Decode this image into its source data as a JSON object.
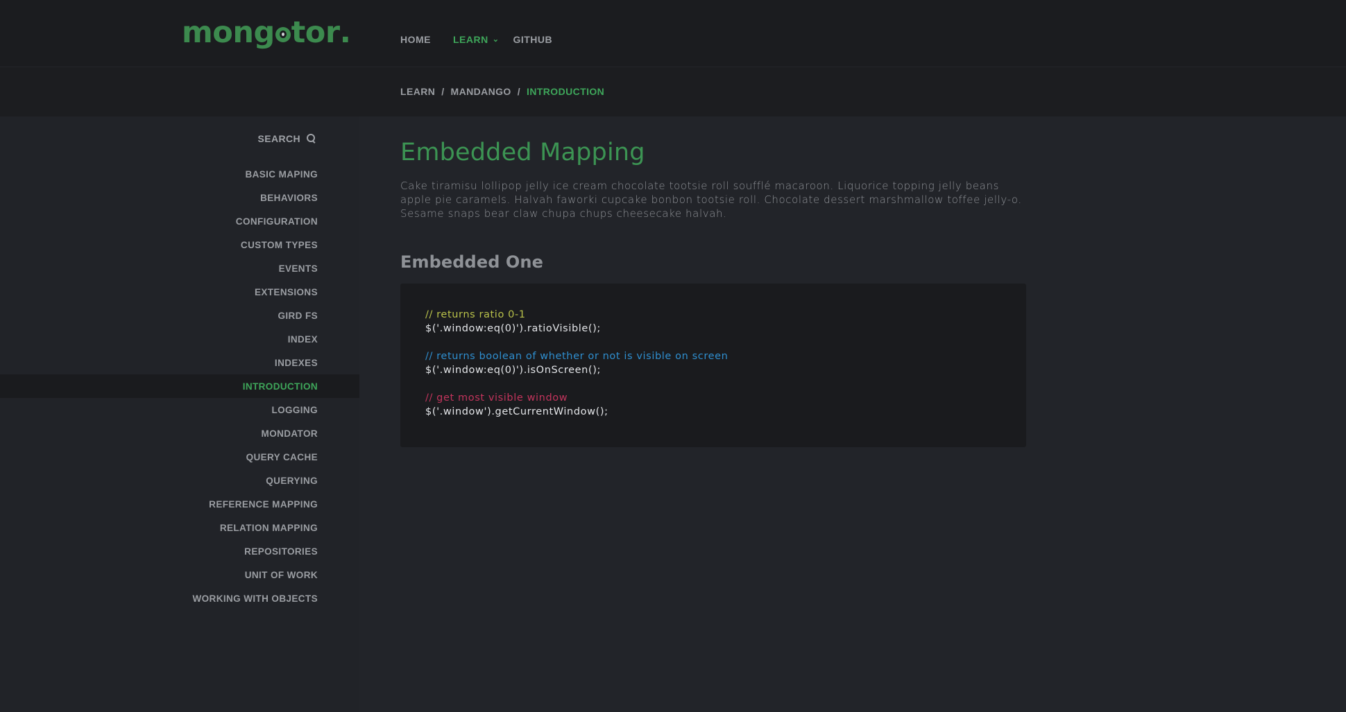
{
  "brand": {
    "logo_prefix": "mong",
    "logo_suffix": "tor",
    "logo_dot": ".",
    "accent": "#3ea65a"
  },
  "nav": {
    "items": [
      {
        "label": "HOME"
      },
      {
        "label": "LEARN",
        "active": true,
        "has_dropdown": true
      },
      {
        "label": "GITHUB"
      }
    ]
  },
  "breadcrumb": {
    "items": [
      "LEARN",
      "MANDANGO",
      "INTRODUCTION"
    ],
    "separator": "/"
  },
  "sidebar": {
    "search_label": "SEARCH",
    "items": [
      {
        "label": "BASIC MAPING"
      },
      {
        "label": "BEHAVIORS"
      },
      {
        "label": "CONFIGURATION"
      },
      {
        "label": "CUSTOM TYPES"
      },
      {
        "label": "EVENTS"
      },
      {
        "label": "EXTENSIONS"
      },
      {
        "label": "GIRD FS"
      },
      {
        "label": "INDEX"
      },
      {
        "label": "INDEXES"
      },
      {
        "label": "INTRODUCTION",
        "active": true
      },
      {
        "label": "LOGGING"
      },
      {
        "label": "MONDATOR"
      },
      {
        "label": "QUERY CACHE"
      },
      {
        "label": "QUERYING"
      },
      {
        "label": "REFERENCE MAPPING"
      },
      {
        "label": "RELATION MAPPING"
      },
      {
        "label": "REPOSITORIES"
      },
      {
        "label": "UNIT OF WORK"
      },
      {
        "label": "WORKING WITH OBJECTS"
      }
    ]
  },
  "main": {
    "title": "Embedded Mapping",
    "intro": "Cake tiramisu lollipop jelly ice cream chocolate tootsie roll soufflé macaroon. Liquorice topping jelly beans apple pie caramels. Halvah faworki cupcake bonbon tootsie roll. Chocolate dessert marshmallow toffee jelly-o. Sesame snaps bear claw chupa chups cheesecake halvah.",
    "section_title": "Embedded One",
    "code": {
      "comment_1": "// returns ratio 0-1",
      "line_1": "$('.window:eq(0)').ratioVisible();",
      "comment_2": "// returns boolean of whether or not is visible on screen",
      "line_2": "$('.window:eq(0)').isOnScreen();",
      "comment_3": "// get most visible window",
      "line_3": "$('.window').getCurrentWindow();",
      "colors": {
        "comment_1": "#b9c24a",
        "comment_2": "#2f8fd0",
        "comment_3": "#c2345c"
      }
    }
  }
}
